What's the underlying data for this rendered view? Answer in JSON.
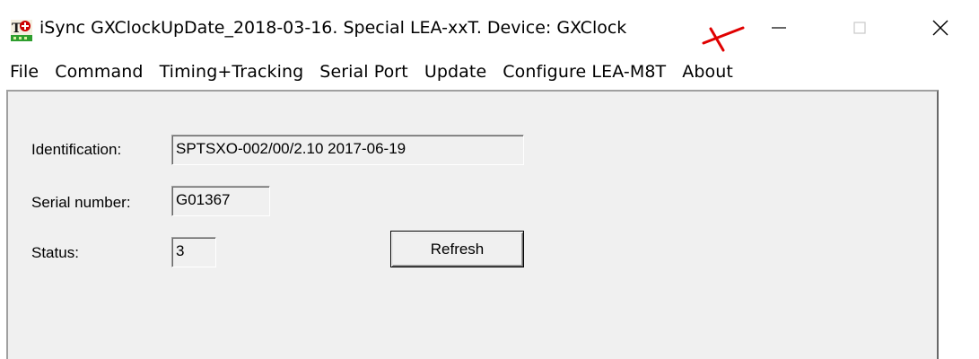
{
  "window": {
    "title": "iSync GXClockUpDate_2018-03-16. Special LEA-xxT. Device: GXClock",
    "app_icon": "isync-app-icon",
    "caption_buttons": {
      "minimize": "minimize-icon",
      "maximize": "maximize-icon",
      "close": "close-icon"
    },
    "annotation": "red-x-mark"
  },
  "menu": {
    "items": [
      {
        "label": "File"
      },
      {
        "label": "Command"
      },
      {
        "label": "Timing+Tracking"
      },
      {
        "label": "Serial Port"
      },
      {
        "label": "Update"
      },
      {
        "label": "Configure LEA-M8T"
      },
      {
        "label": "About"
      }
    ]
  },
  "form": {
    "identification": {
      "label": "Identification:",
      "value": "SPTSXO-002/00/2.10 2017-06-19"
    },
    "serial_number": {
      "label": "Serial number:",
      "value": "G01367"
    },
    "status": {
      "label": "Status:",
      "value": "3"
    },
    "refresh_button": "Refresh"
  },
  "colors": {
    "client_background": "#f0f0f0",
    "annotation_red": "#e00000",
    "icon_red": "#cc0000",
    "icon_green": "#2e9e2e"
  }
}
